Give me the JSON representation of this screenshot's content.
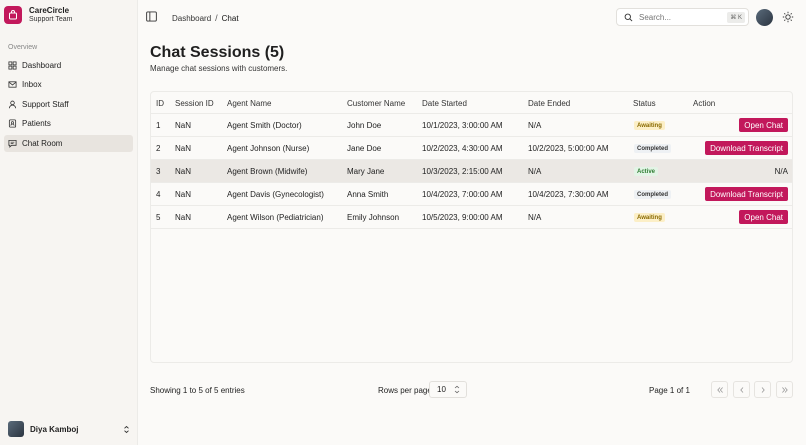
{
  "brand": {
    "name": "CareCircle",
    "subtitle": "Support Team",
    "logo_icon": "shopping-bag-icon"
  },
  "sidebar": {
    "section_label": "Overview",
    "items": [
      {
        "label": "Dashboard",
        "icon": "dashboard-icon",
        "active": false
      },
      {
        "label": "Inbox",
        "icon": "mail-icon",
        "active": false
      },
      {
        "label": "Support Staff",
        "icon": "user-icon",
        "active": false
      },
      {
        "label": "Patients",
        "icon": "contacts-icon",
        "active": false
      },
      {
        "label": "Chat Room",
        "icon": "chat-icon",
        "active": true
      }
    ],
    "user": {
      "name": "Diya Kamboj"
    }
  },
  "topbar": {
    "breadcrumb": [
      "Dashboard",
      "Chat"
    ],
    "search_placeholder": "Search...",
    "search_shortcut": "⌘ K"
  },
  "page": {
    "title": "Chat Sessions (5)",
    "subtitle": "Manage chat sessions with customers."
  },
  "table": {
    "columns": [
      "ID",
      "Session ID",
      "Agent Name",
      "Customer Name",
      "Date Started",
      "Date Ended",
      "Status",
      "Action"
    ],
    "rows": [
      {
        "id": "1",
        "session": "NaN",
        "agent": "Agent Smith (Doctor)",
        "customer": "John Doe",
        "started": "10/1/2023, 3:00:00 AM",
        "ended": "N/A",
        "status": "Awaiting",
        "action": "Open Chat"
      },
      {
        "id": "2",
        "session": "NaN",
        "agent": "Agent Johnson (Nurse)",
        "customer": "Jane Doe",
        "started": "10/2/2023, 4:30:00 AM",
        "ended": "10/2/2023, 5:00:00 AM",
        "status": "Completed",
        "action": "Download Transcript"
      },
      {
        "id": "3",
        "session": "NaN",
        "agent": "Agent Brown (Midwife)",
        "customer": "Mary Jane",
        "started": "10/3/2023, 2:15:00 AM",
        "ended": "N/A",
        "status": "Active",
        "action": "N/A"
      },
      {
        "id": "4",
        "session": "NaN",
        "agent": "Agent Davis (Gynecologist)",
        "customer": "Anna Smith",
        "started": "10/4/2023, 7:00:00 AM",
        "ended": "10/4/2023, 7:30:00 AM",
        "status": "Completed",
        "action": "Download Transcript"
      },
      {
        "id": "5",
        "session": "NaN",
        "agent": "Agent Wilson (Pediatrician)",
        "customer": "Emily Johnson",
        "started": "10/5/2023, 9:00:00 AM",
        "ended": "N/A",
        "status": "Awaiting",
        "action": "Open Chat"
      }
    ]
  },
  "footer": {
    "showing": "Showing 1 to 5 of 5 entries",
    "rows_per_page_label": "Rows per page",
    "rows_per_page_value": "10",
    "page_info": "Page 1 of 1"
  },
  "colors": {
    "accent": "#c2185b",
    "awaiting_bg": "#fcefc7",
    "active_text": "#2e7d32"
  }
}
